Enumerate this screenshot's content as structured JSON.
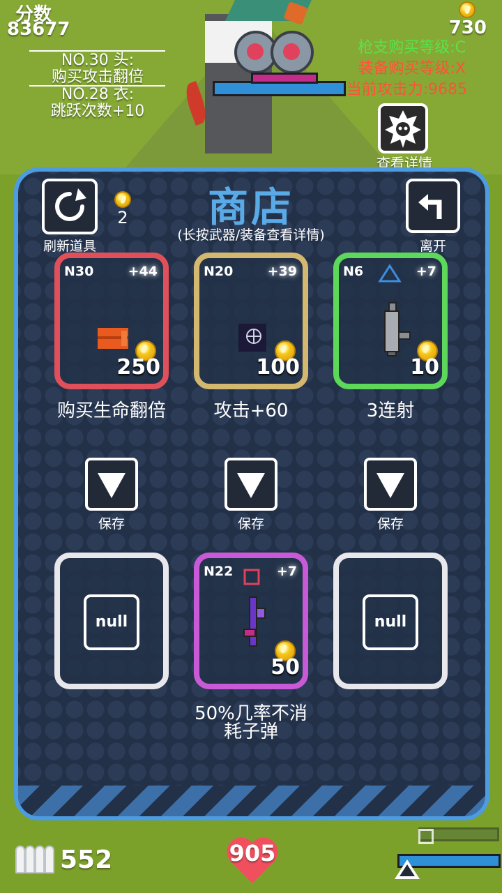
{
  "hud": {
    "score_label": "分数",
    "score_value": "83677",
    "gold_value": "730",
    "log": [
      {
        "line1": "NO.30 头:",
        "line2": "购买攻击翻倍"
      },
      {
        "line1": "NO.28 衣:",
        "line2": "跳跃次数+10"
      }
    ],
    "gun_level": "枪支购买等级:C",
    "equip_level": "装备购买等级:X",
    "attack_power": "当前攻击力:9685",
    "detail_label": "查看详情",
    "ammo": "552",
    "health": "905"
  },
  "shop": {
    "title": "商店",
    "hint": "(长按武器/装备查看详情)",
    "refresh_label": "刷新道具",
    "refresh_cost": "2",
    "leave_label": "离开",
    "cards": [
      {
        "code": "N30",
        "plus": "+44",
        "price": "250",
        "desc": "购买生命翻倍",
        "border": "#e0505a"
      },
      {
        "code": "N20",
        "plus": "+39",
        "price": "100",
        "desc": "攻击+60",
        "border": "#d4b870"
      },
      {
        "code": "N6",
        "plus": "+7",
        "price": "10",
        "desc": "3连射",
        "border": "#5ed85a"
      }
    ],
    "save_label": "保存",
    "slots": [
      {
        "type": "empty",
        "text": "null"
      },
      {
        "type": "item",
        "code": "N22",
        "plus": "+7",
        "price": "50",
        "desc_line1": "50%几率不消",
        "desc_line2": "耗子弹",
        "border": "#c85ad8"
      },
      {
        "type": "empty",
        "text": "null"
      }
    ]
  }
}
